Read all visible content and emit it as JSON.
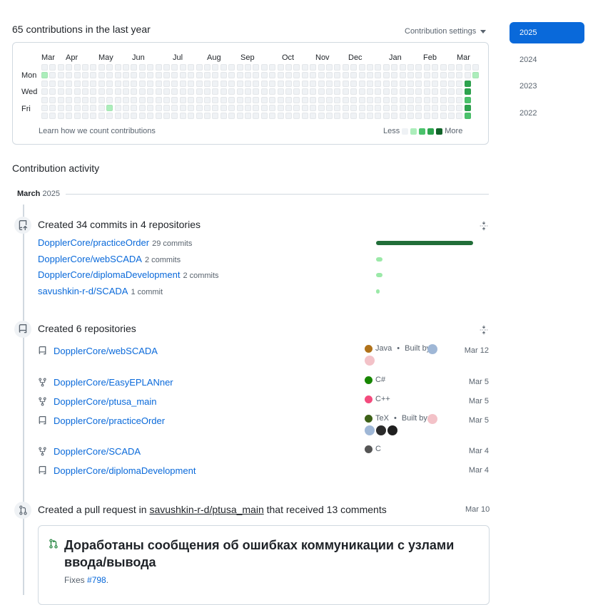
{
  "header": {
    "contributions_title": "65 contributions in the last year",
    "settings_label": "Contribution settings"
  },
  "calendar": {
    "months": [
      "Mar",
      "Apr",
      "May",
      "Jun",
      "Jul",
      "Aug",
      "Sep",
      "Oct",
      "Nov",
      "Dec",
      "Jan",
      "Feb",
      "Mar"
    ],
    "day_labels": [
      "Mon",
      "Wed",
      "Fri"
    ],
    "learn_link": "Learn how we count contributions",
    "legend_less": "Less",
    "legend_more": "More",
    "colors": [
      "#eff2f5",
      "#aceebb",
      "#4ac26b",
      "#2da44e",
      "#116329"
    ],
    "active_cells": [
      {
        "week": 0,
        "day": 1,
        "level": 1
      },
      {
        "week": 8,
        "day": 5,
        "level": 1
      },
      {
        "week": 52,
        "day": 2,
        "level": 3
      },
      {
        "week": 52,
        "day": 3,
        "level": 3
      },
      {
        "week": 52,
        "day": 4,
        "level": 2
      },
      {
        "week": 52,
        "day": 5,
        "level": 3
      },
      {
        "week": 52,
        "day": 6,
        "level": 2
      },
      {
        "week": 53,
        "day": 1,
        "level": 1
      },
      {
        "week": 53,
        "day": 2,
        "level": 3
      },
      {
        "week": 53,
        "day": 3,
        "level": 3
      },
      {
        "week": 53,
        "day": 5,
        "level": 4
      },
      {
        "week": 54,
        "day": 1,
        "level": 3
      }
    ]
  },
  "years": [
    "2025",
    "2024",
    "2023",
    "2022"
  ],
  "activity": {
    "title": "Contribution activity",
    "month": "March",
    "year": "2025",
    "commits_section": {
      "title": "Created 34 commits in 4 repositories",
      "repos": [
        {
          "name": "DopplerCore/practiceOrder",
          "count": "29 commits",
          "value": 29
        },
        {
          "name": "DopplerCore/webSCADA",
          "count": "2 commits",
          "value": 2
        },
        {
          "name": "DopplerCore/diplomaDevelopment",
          "count": "2 commits",
          "value": 2
        },
        {
          "name": "savushkin-r-d/SCADA",
          "count": "1 commit",
          "value": 1
        }
      ]
    },
    "repos_section": {
      "title": "Created 6 repositories",
      "built_by": "Built by",
      "repos": [
        {
          "name": "DopplerCore/webSCADA",
          "icon": "repo-icon",
          "language": "Java",
          "lang_color": "#b07219",
          "built_by": true,
          "date": "Mar 12"
        },
        {
          "name": "DopplerCore/EasyEPLANner",
          "icon": "fork-icon",
          "language": "C#",
          "lang_color": "#178600",
          "built_by": false,
          "date": "Mar 5"
        },
        {
          "name": "DopplerCore/ptusa_main",
          "icon": "fork-icon",
          "language": "C++",
          "lang_color": "#f34b7d",
          "built_by": false,
          "date": "Mar 5"
        },
        {
          "name": "DopplerCore/practiceOrder",
          "icon": "repo-icon",
          "language": "TeX",
          "lang_color": "#3D6117",
          "built_by": true,
          "date": "Mar 5"
        },
        {
          "name": "DopplerCore/SCADA",
          "icon": "fork-icon",
          "language": "C",
          "lang_color": "#555555",
          "built_by": false,
          "date": "Mar 4"
        },
        {
          "name": "DopplerCore/diplomaDevelopment",
          "icon": "repo-icon",
          "language": "",
          "lang_color": "",
          "built_by": false,
          "date": "Mar 4"
        }
      ]
    },
    "pr_section": {
      "title_prefix": "Created a pull request in",
      "repo": "savushkin-r-d/ptusa_main",
      "title_suffix": "that received 13 comments",
      "date": "Mar 10",
      "pr_title": "Доработаны сообщения об ошибках коммуникации с узлами ввода/вывода",
      "fixes_prefix": "Fixes",
      "fixes_link": "#798",
      "fixes_suffix": "."
    }
  }
}
